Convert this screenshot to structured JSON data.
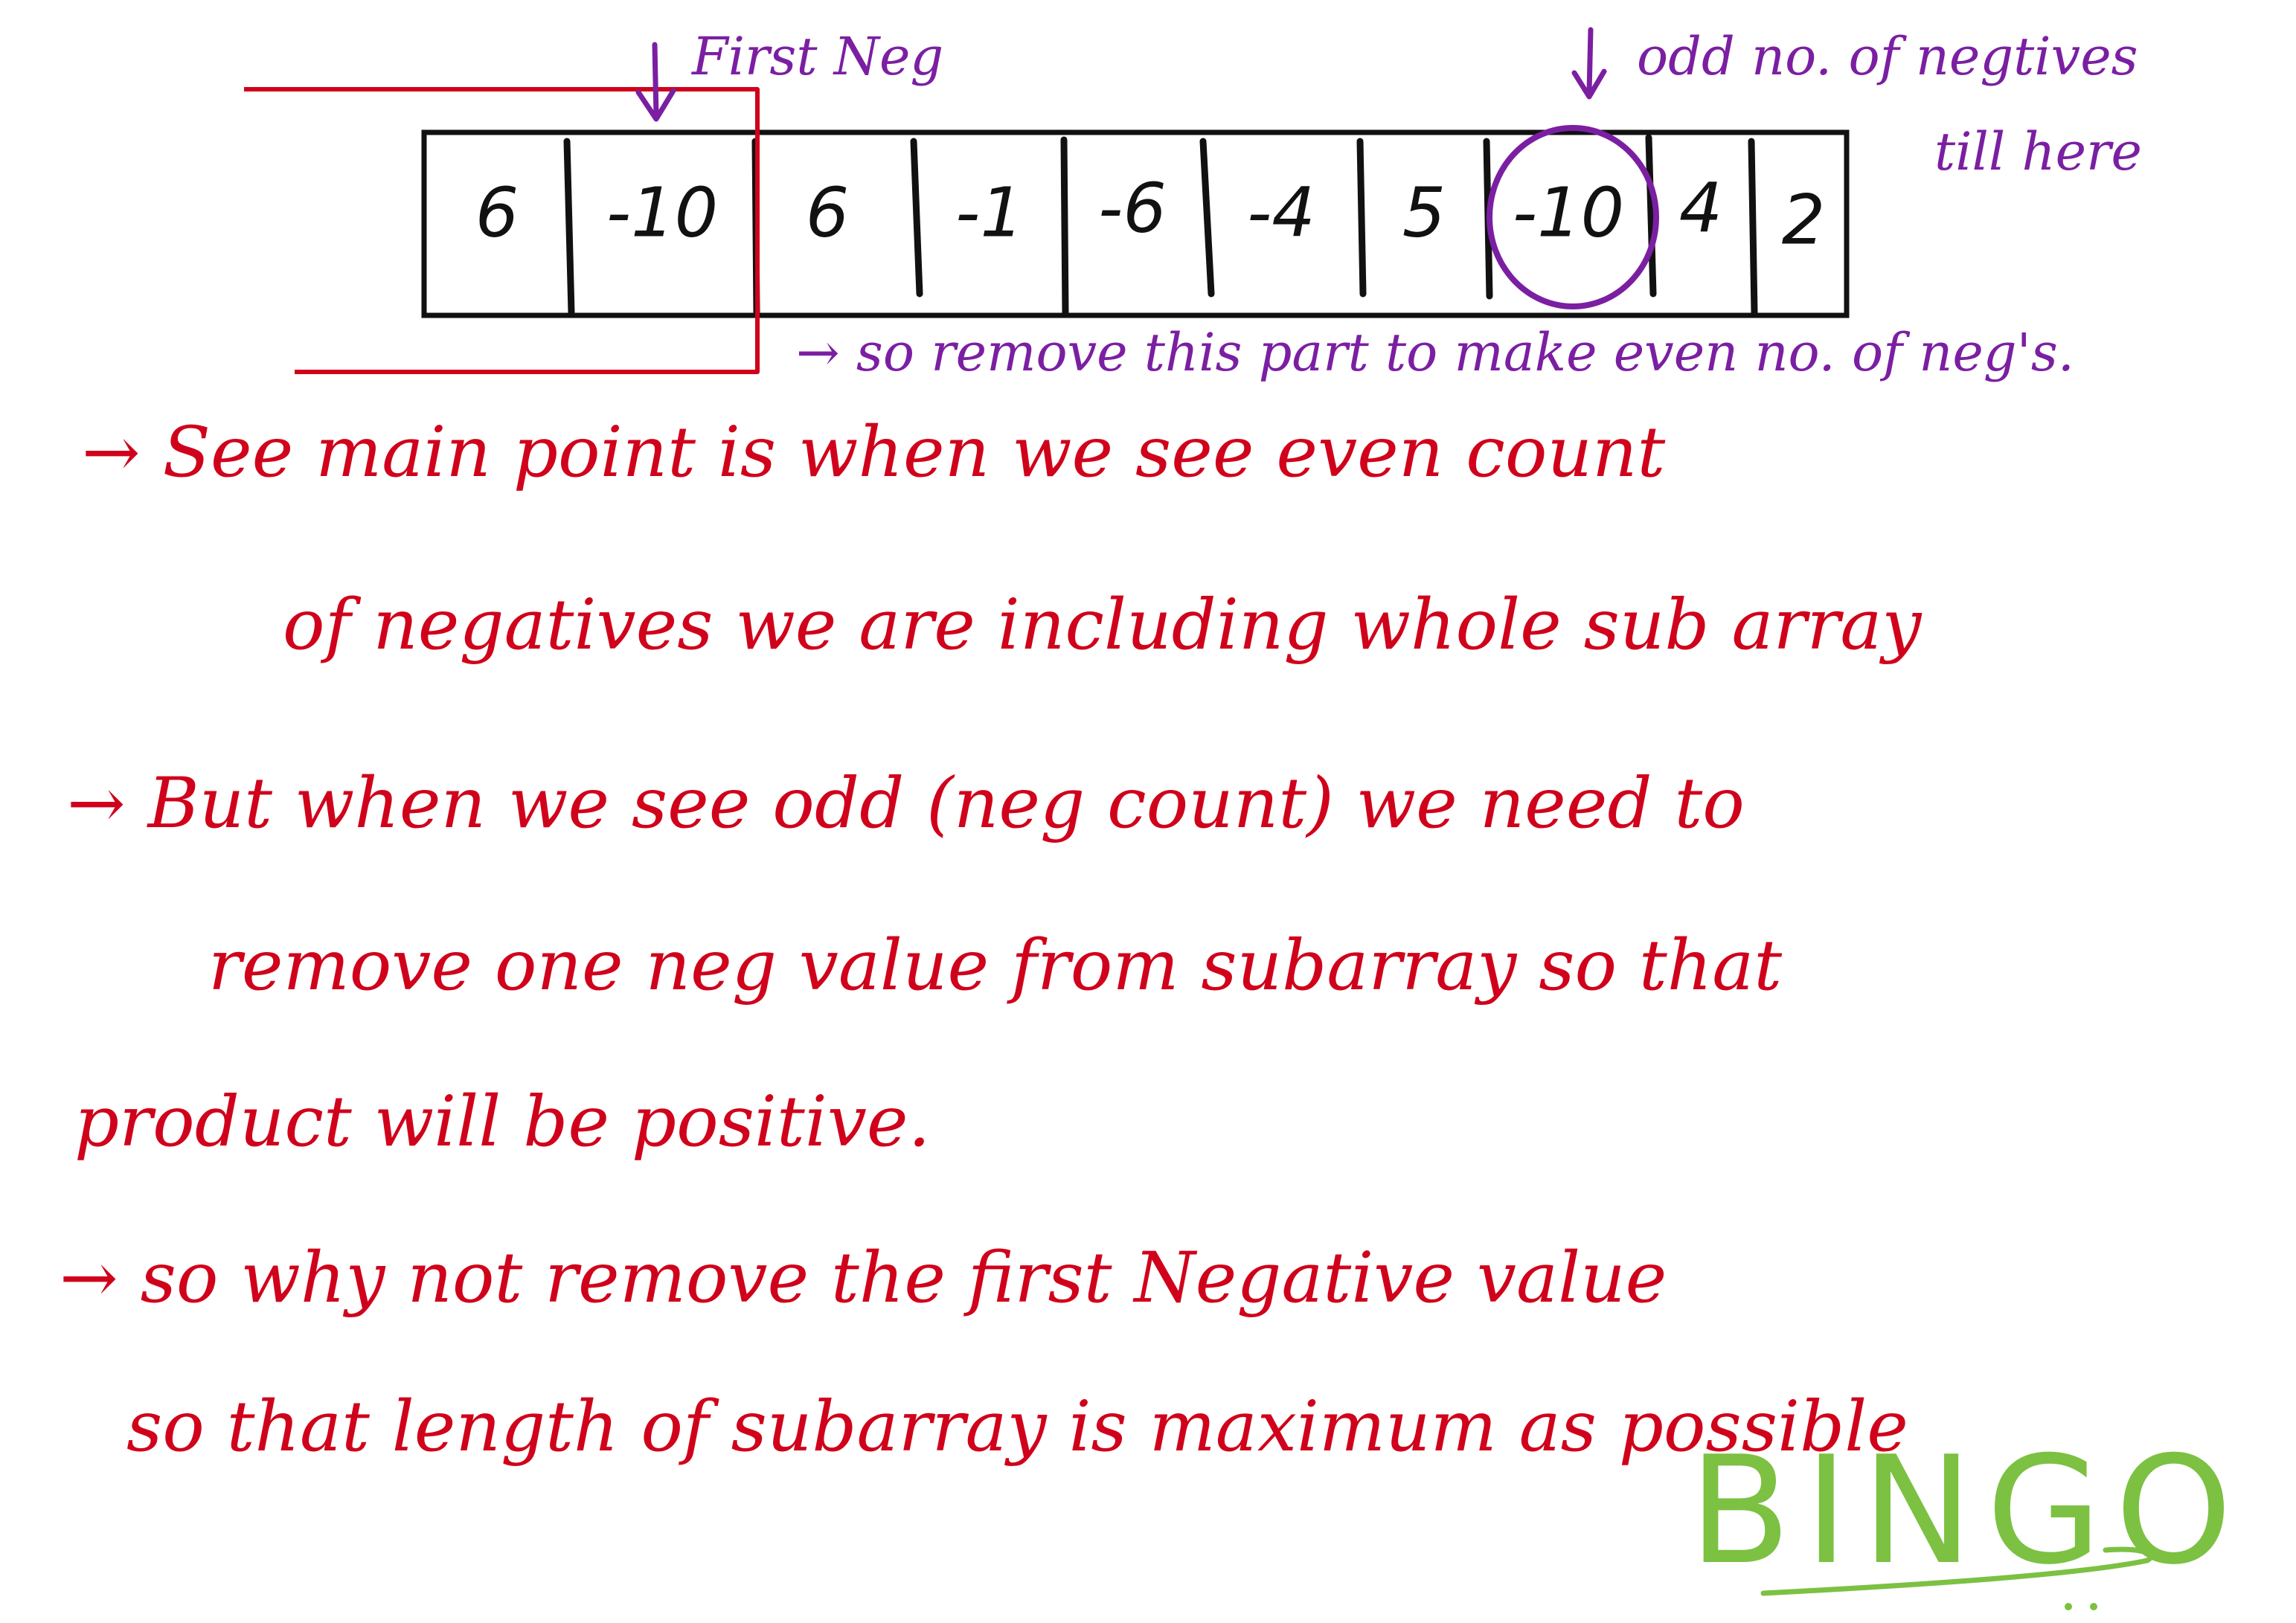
{
  "array": {
    "cells": [
      "6",
      "-10",
      "6",
      "-1",
      "-6",
      "-4",
      "5",
      "-10",
      "4",
      "2"
    ]
  },
  "annotations": {
    "first_neg": "First Neg",
    "odd_line1": "odd no. of negtives",
    "odd_line2": "till here",
    "remove_part": "→ so remove this part to make even no. of neg's."
  },
  "notes": {
    "line1": "→ See main point is when we see even count",
    "line2": "of negatives we are including whole sub array",
    "line3": "→ But when we see odd (neg count) we need to",
    "line4": "remove one neg value from subarray so that",
    "line5": "product will be positive.",
    "line6": "→ so why not remove the first Negative value",
    "line7": "so that length of subarray is maximum as possible"
  },
  "bingo": "BINGO",
  "colors": {
    "ink_black": "#111111",
    "ink_red": "#d0021b",
    "ink_purple": "#7b1fa2",
    "ink_green": "#7cc142"
  }
}
